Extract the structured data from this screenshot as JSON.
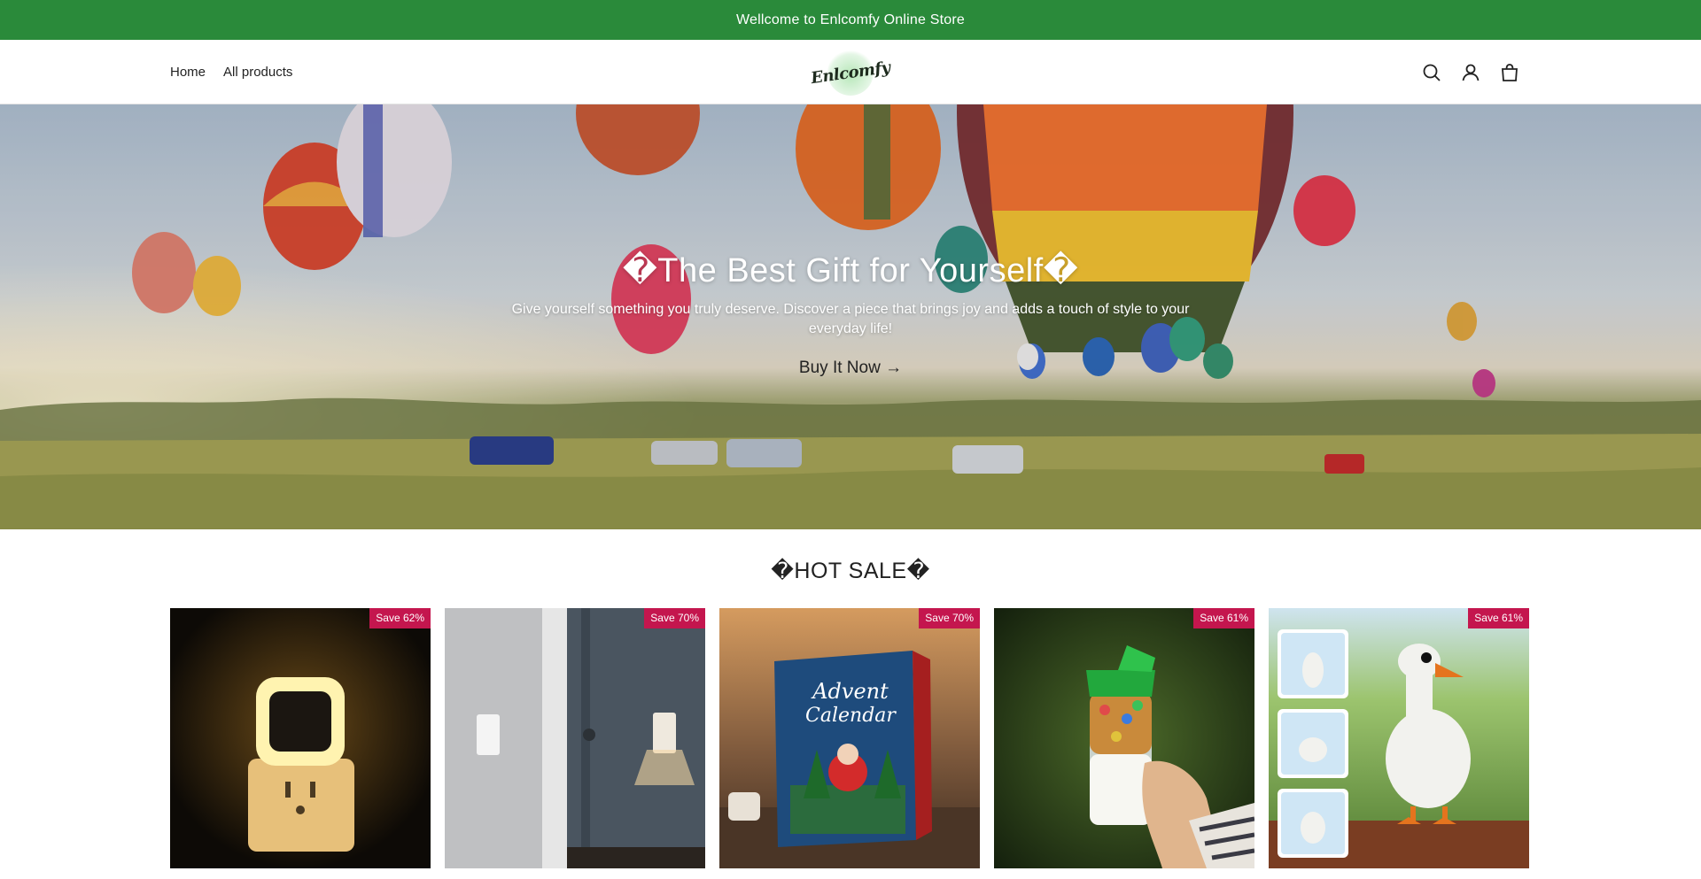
{
  "announcement": {
    "text": "Wellcome to Enlcomfy Online Store"
  },
  "header": {
    "nav": [
      {
        "label": "Home"
      },
      {
        "label": "All products"
      }
    ],
    "logo_text": "Enlcomfy",
    "icons": [
      "search-icon",
      "account-icon",
      "cart-icon"
    ]
  },
  "hero": {
    "title": "�The Best Gift for Yourself�",
    "subtitle": "Give yourself something you truly deserve. Discover a piece that brings joy and adds a touch of style to your everyday life!",
    "cta": "Buy It Now →"
  },
  "hot_sale": {
    "title": "�HOT SALE�",
    "products": [
      {
        "badge": "Save 62%",
        "image": "night-light-product-image"
      },
      {
        "badge": "Save 70%",
        "image": "wall-outlet-light-product-image"
      },
      {
        "badge": "Save 70%",
        "image": "advent-calendar-product-image"
      },
      {
        "badge": "Save 61%",
        "image": "cereal-cup-product-image"
      },
      {
        "badge": "Save 61%",
        "image": "duck-statue-product-image"
      }
    ]
  },
  "colors": {
    "announcement_bg": "#2a8a3a",
    "badge_bg": "#c4164e"
  }
}
